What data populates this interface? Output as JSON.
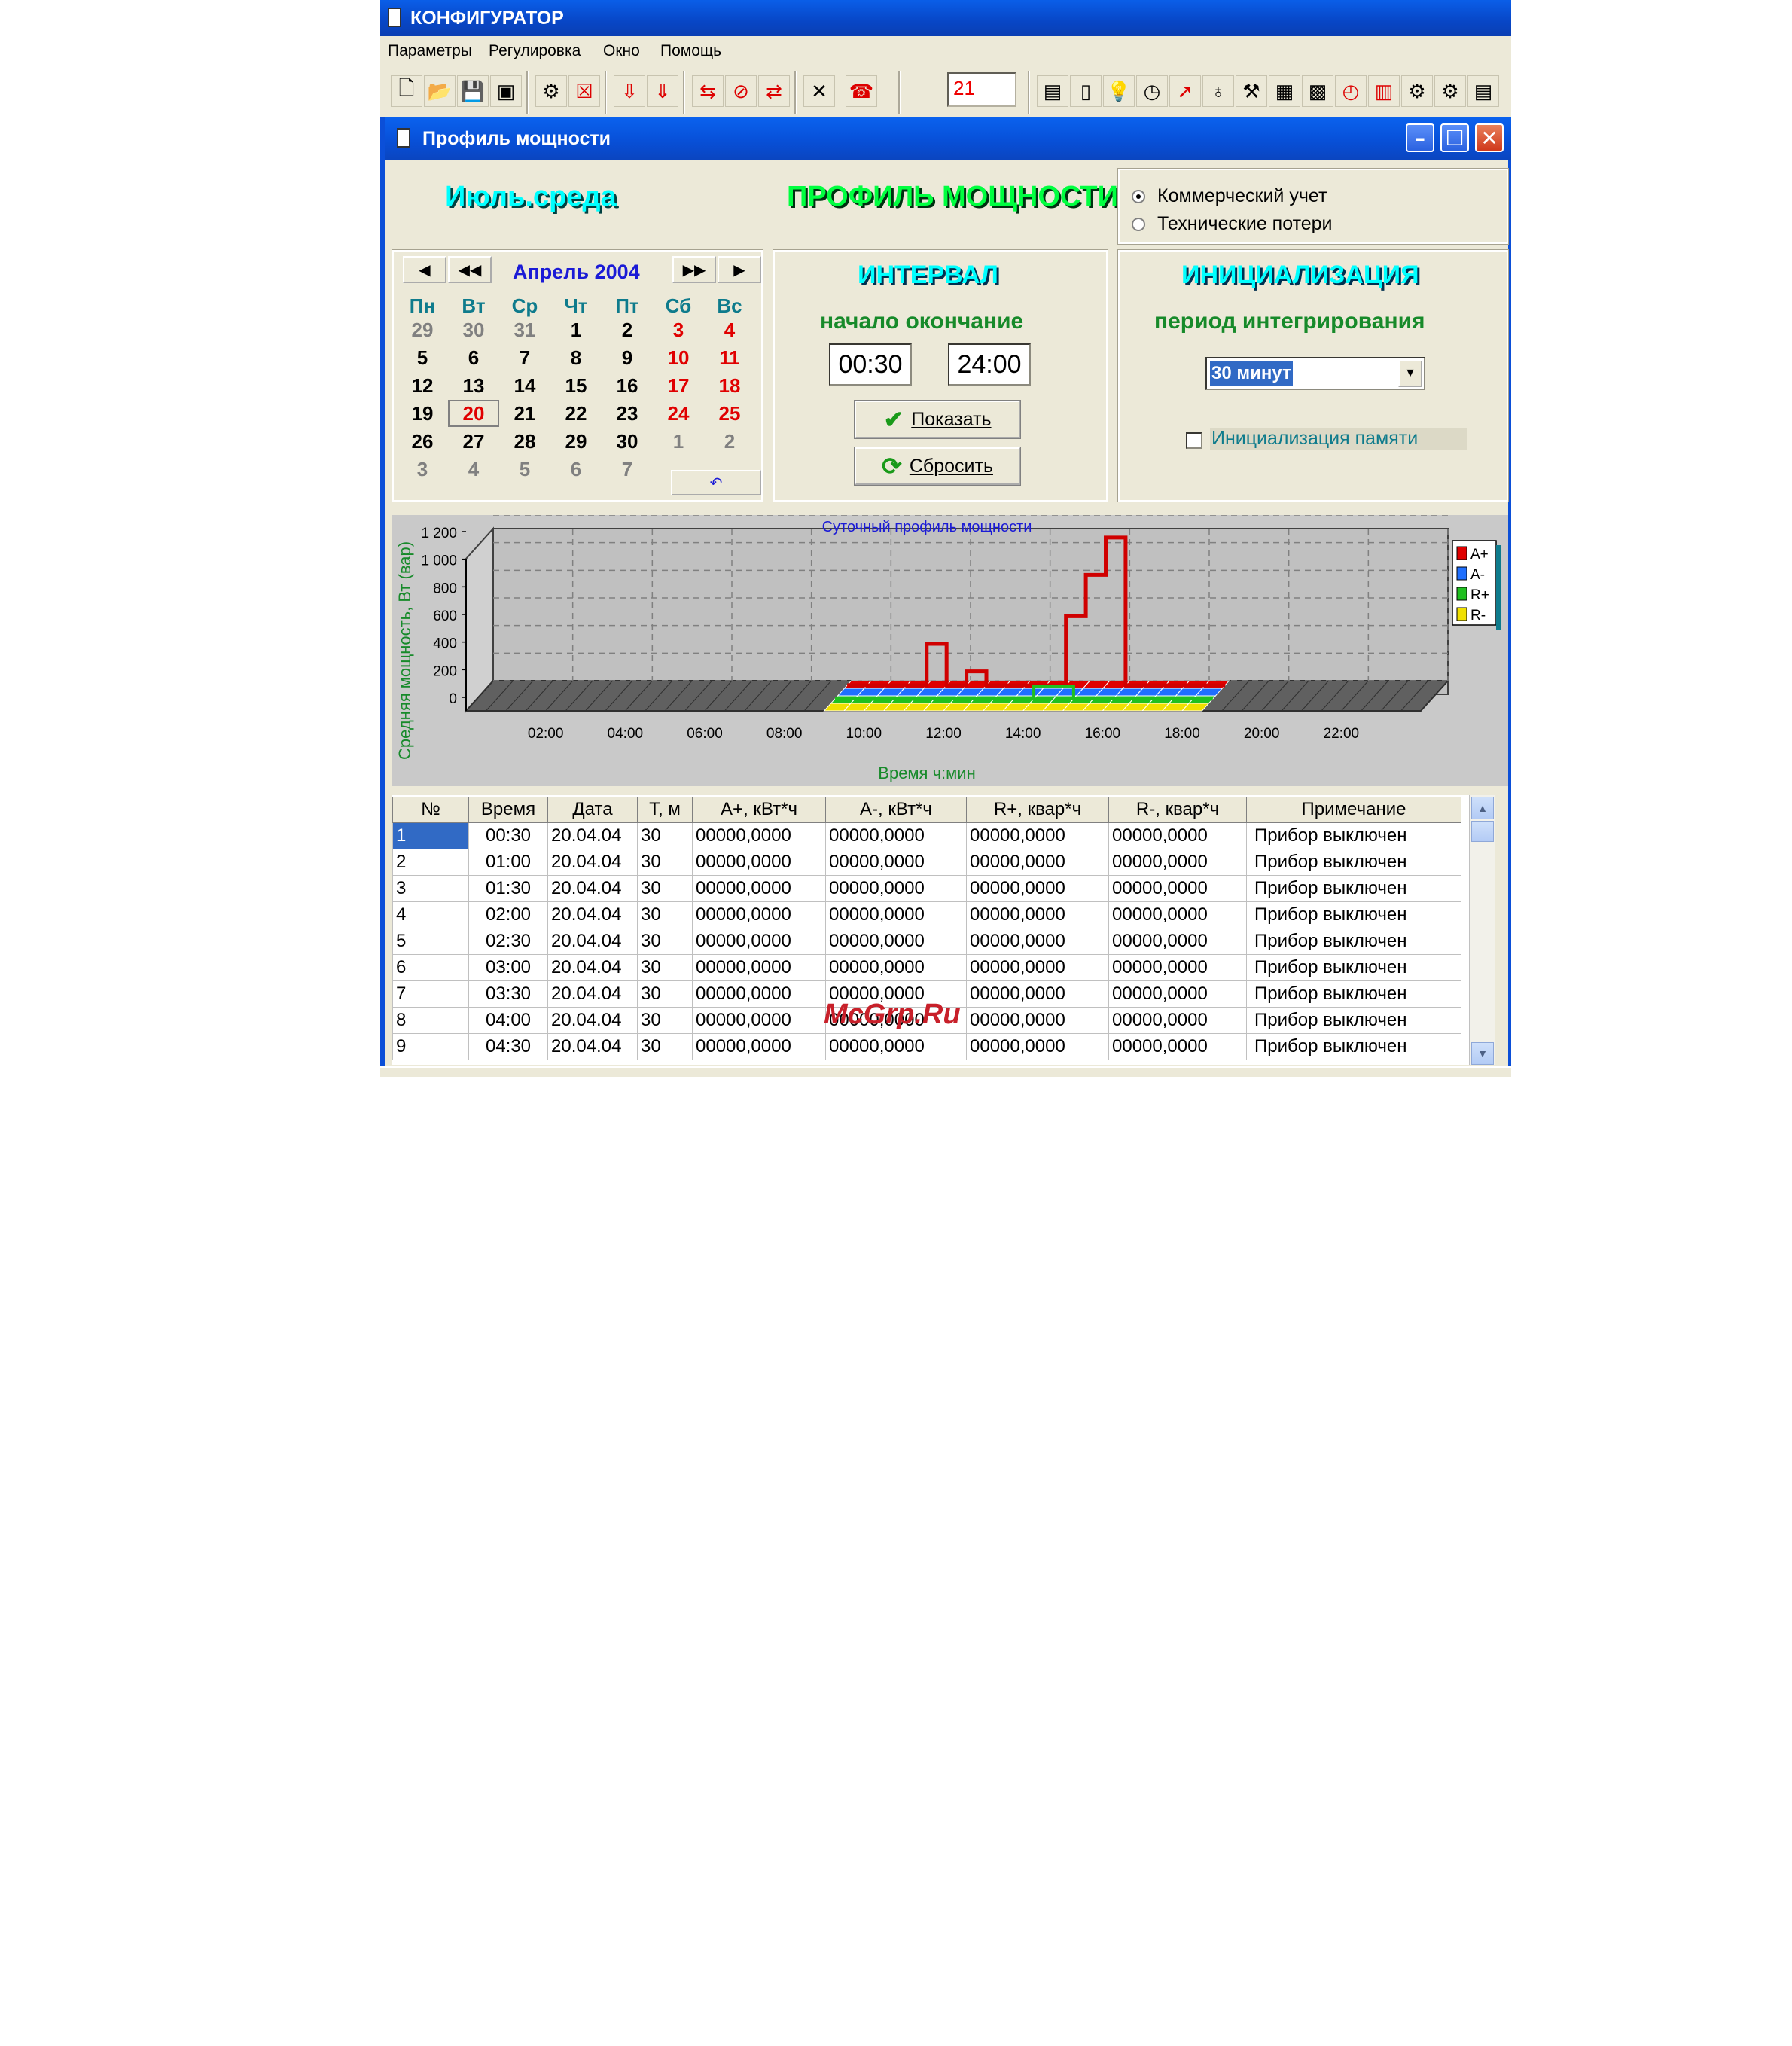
{
  "app": {
    "title": "КОНФИГУРАТОР"
  },
  "menu": [
    "Параметры",
    "Регулировка",
    "Окно",
    "Помощь"
  ],
  "toolbar": {
    "counter_value": "21"
  },
  "window": {
    "title": "Профиль мощности"
  },
  "header": {
    "day_label": "Июль.среда",
    "main_title": "ПРОФИЛЬ МОЩНОСТИ"
  },
  "mode": {
    "options": [
      "Коммерческий учет",
      "Технические потери"
    ],
    "selected": "Коммерческий учет"
  },
  "calendar": {
    "month_label": "Апрель 2004",
    "weekdays": [
      "Пн",
      "Вт",
      "Ср",
      "Чт",
      "Пт",
      "Сб",
      "Вс"
    ],
    "selected_day": "20",
    "weeks": [
      [
        "29",
        "30",
        "31",
        "1",
        "2",
        "3",
        "4"
      ],
      [
        "5",
        "6",
        "7",
        "8",
        "9",
        "10",
        "11"
      ],
      [
        "12",
        "13",
        "14",
        "15",
        "16",
        "17",
        "18"
      ],
      [
        "19",
        "20",
        "21",
        "22",
        "23",
        "24",
        "25"
      ],
      [
        "26",
        "27",
        "28",
        "29",
        "30",
        "1",
        "2"
      ],
      [
        "3",
        "4",
        "5",
        "6",
        "7"
      ]
    ]
  },
  "interval": {
    "title": "ИНТЕРВАЛ",
    "subtitle": "начало окончание",
    "start": "00:30",
    "end": "24:00",
    "show_label": "Показать",
    "reset_label": "Сбросить"
  },
  "init": {
    "title": "ИНИЦИАЛИЗАЦИЯ",
    "subtitle": "период интегрирования",
    "period_value": "30 минут",
    "memory_label": "Инициализация памяти",
    "memory_checked": false
  },
  "chart_data": {
    "type": "line",
    "title": "Суточный профиль мощности",
    "xlabel": "Время ч:мин",
    "ylabel": "Средняя мощность, Вт (вар)",
    "x_ticks": [
      "02:00",
      "04:00",
      "06:00",
      "08:00",
      "10:00",
      "12:00",
      "14:00",
      "16:00",
      "18:00",
      "20:00",
      "22:00"
    ],
    "y_ticks": [
      "0",
      "200",
      "400",
      "600",
      "800",
      "1 000",
      "1 200"
    ],
    "ylim": [
      0,
      1200
    ],
    "x": [
      "09:30",
      "10:00",
      "10:30",
      "11:00",
      "11:30",
      "12:00",
      "12:30",
      "13:00",
      "13:30",
      "14:00",
      "14:30",
      "15:00",
      "15:30",
      "16:00",
      "16:30",
      "17:00",
      "17:30",
      "18:00",
      "18:30"
    ],
    "series": [
      {
        "name": "A+",
        "color": "#e00000",
        "values": [
          0,
          0,
          0,
          0,
          300,
          0,
          100,
          0,
          0,
          0,
          0,
          500,
          800,
          1070,
          0,
          0,
          0,
          0,
          0
        ]
      },
      {
        "name": "A-",
        "color": "#1f6fff",
        "values": [
          0,
          0,
          0,
          0,
          0,
          0,
          0,
          0,
          0,
          0,
          0,
          0,
          0,
          0,
          0,
          0,
          0,
          0,
          0
        ]
      },
      {
        "name": "R+",
        "color": "#20c020",
        "values": [
          0,
          0,
          0,
          0,
          0,
          0,
          0,
          0,
          0,
          0,
          30,
          30,
          0,
          0,
          0,
          0,
          0,
          0,
          0
        ]
      },
      {
        "name": "R-",
        "color": "#f0e000",
        "values": [
          0,
          0,
          0,
          0,
          0,
          0,
          0,
          0,
          0,
          0,
          0,
          0,
          0,
          0,
          0,
          0,
          0,
          0,
          0
        ]
      }
    ],
    "legend": "right",
    "grid": true
  },
  "table": {
    "columns": [
      "№",
      "Время",
      "Дата",
      "Т, м",
      "А+, кВт*ч",
      "А-, кВт*ч",
      "R+, квар*ч",
      "R-, квар*ч",
      "Примечание"
    ],
    "rows": [
      [
        "1",
        "00:30",
        "20.04.04",
        "30",
        "00000,0000",
        "00000,0000",
        "00000,0000",
        "00000,0000",
        "Прибор выключен"
      ],
      [
        "2",
        "01:00",
        "20.04.04",
        "30",
        "00000,0000",
        "00000,0000",
        "00000,0000",
        "00000,0000",
        "Прибор выключен"
      ],
      [
        "3",
        "01:30",
        "20.04.04",
        "30",
        "00000,0000",
        "00000,0000",
        "00000,0000",
        "00000,0000",
        "Прибор выключен"
      ],
      [
        "4",
        "02:00",
        "20.04.04",
        "30",
        "00000,0000",
        "00000,0000",
        "00000,0000",
        "00000,0000",
        "Прибор выключен"
      ],
      [
        "5",
        "02:30",
        "20.04.04",
        "30",
        "00000,0000",
        "00000,0000",
        "00000,0000",
        "00000,0000",
        "Прибор выключен"
      ],
      [
        "6",
        "03:00",
        "20.04.04",
        "30",
        "00000,0000",
        "00000,0000",
        "00000,0000",
        "00000,0000",
        "Прибор выключен"
      ],
      [
        "7",
        "03:30",
        "20.04.04",
        "30",
        "00000,0000",
        "00000,0000",
        "00000,0000",
        "00000,0000",
        "Прибор выключен"
      ],
      [
        "8",
        "04:00",
        "20.04.04",
        "30",
        "00000,0000",
        "00000,0000",
        "00000,0000",
        "00000,0000",
        "Прибор выключен"
      ],
      [
        "9",
        "04:30",
        "20.04.04",
        "30",
        "00000,0000",
        "00000,0000",
        "00000,0000",
        "00000,0000",
        "Прибор выключен"
      ]
    ]
  },
  "watermark": "McGrp.Ru",
  "colors": {
    "titlebar": "#0a5ee8",
    "accent_green": "#178a2a",
    "weekend_red": "#e00000",
    "month_blue": "#1b1bd6",
    "selection": "#316ac5"
  }
}
